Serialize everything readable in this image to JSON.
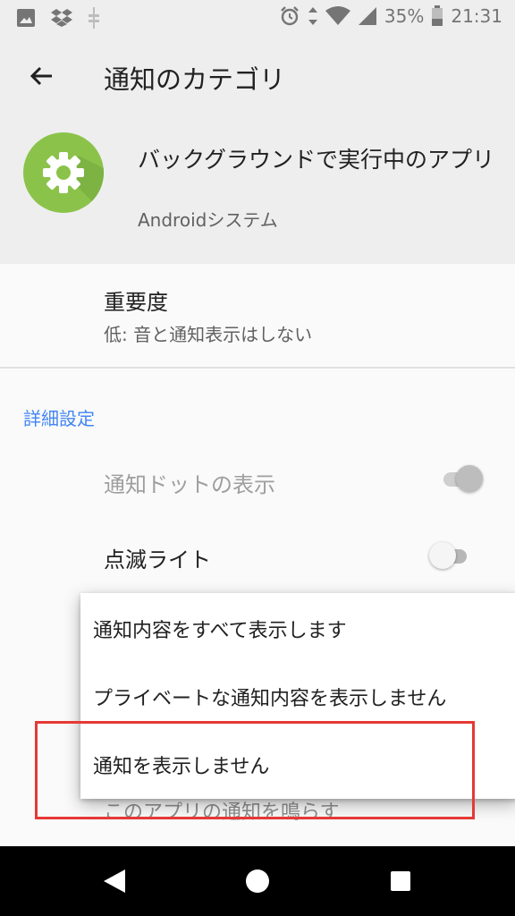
{
  "status_bar": {
    "left_icons": [
      "image-icon",
      "dropbox-icon",
      "usb-debug-icon"
    ],
    "right_icons": [
      "alarm-icon",
      "data-arrows-icon",
      "wifi-icon",
      "signal-icon"
    ],
    "battery": "35%",
    "time": "21:31"
  },
  "app_bar": {
    "title": "通知のカテゴリ",
    "back_icon": "arrow-back-icon"
  },
  "app_header": {
    "icon": "gear-icon",
    "name": "バックグラウンドで実行中のアプリ",
    "subtitle": "Androidシステム",
    "icon_color": "#8bc34a"
  },
  "importance": {
    "title": "重要度",
    "summary": "低: 音と通知表示はしない"
  },
  "advanced": {
    "header": "詳細設定",
    "notification_dot_label": "通知ドットの表示",
    "notification_dot_enabled": true,
    "notification_dot_disabled": true,
    "blink_light_label": "点滅ライト",
    "blink_light_enabled": false,
    "override_dnd_label": "このアプリの通知を鳴らす"
  },
  "lock_screen_menu": {
    "options": [
      "通知内容をすべて表示します",
      "プライベートな通知内容を表示しません",
      "通知を表示しません"
    ]
  },
  "colors": {
    "accent": "#4285f4",
    "highlight": "#e53935"
  },
  "nav_bar": {
    "buttons": [
      "back-triangle-icon",
      "home-circle-icon",
      "recents-square-icon"
    ]
  }
}
